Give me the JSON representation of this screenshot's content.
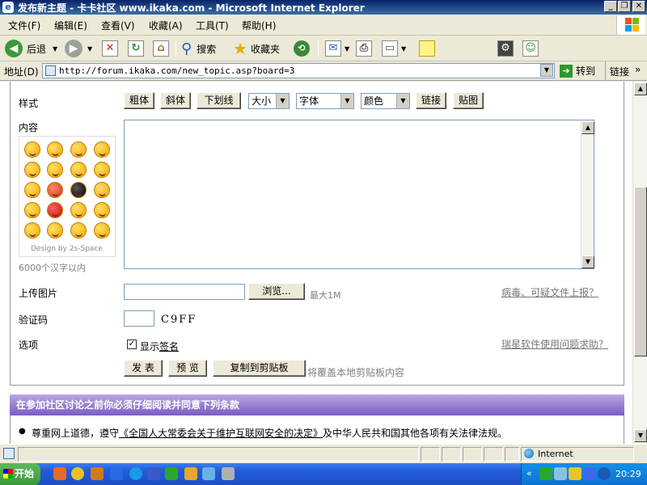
{
  "window": {
    "title": "发布新主题 - 卡卡社区 www.ikaka.com - Microsoft Internet Explorer",
    "btn_minimize": "_",
    "btn_restore": "❐",
    "btn_close": "✕"
  },
  "menu": {
    "items": [
      "文件(F)",
      "编辑(E)",
      "查看(V)",
      "收藏(A)",
      "工具(T)",
      "帮助(H)"
    ]
  },
  "toolbar": {
    "back": "后退",
    "search": "搜索",
    "favorites": "收藏夹"
  },
  "address": {
    "label": "地址(D)",
    "url": "http://forum.ikaka.com/new_topic.asp?board=3",
    "go": "转到",
    "links": "链接",
    "more": "»"
  },
  "form": {
    "style_label": "样式",
    "bold": "粗体",
    "italic": "斜体",
    "underline": "下划线",
    "size_select": "大小",
    "font_select": "字体",
    "color_select": "颜色",
    "link": "链接",
    "image": "贴图",
    "content_label": "内容",
    "emoji_credit": "Design by 2s-Space",
    "char_limit": "6000个汉字以内",
    "upload_label": "上传图片",
    "browse": "浏览...",
    "max_size": "最大1M",
    "virus_report": "病毒、可疑文件上报？",
    "captcha_label": "验证码",
    "captcha_code": "C9FF",
    "options_label": "选项",
    "show_sig_prefix": "显示",
    "show_sig_link": "签名",
    "rising_help": "瑞星软件使用问题求助？",
    "submit": "发 表",
    "preview": "预 览",
    "copy_clipboard": "复制到剪贴板",
    "clipboard_note": "将覆盖本地剪贴板内容"
  },
  "terms": {
    "header": "在参加社区讨论之前你必须仔细阅读并同意下列条款",
    "item1_a": "尊重网上道德，遵守",
    "item1_link": "《全国人大常委会关于维护互联网安全的决定》",
    "item1_b": "及中华人民共和国其他各项有关法律法规。"
  },
  "status": {
    "zone": "Internet"
  },
  "taskbar": {
    "start": "开始",
    "clock": "20:29"
  }
}
